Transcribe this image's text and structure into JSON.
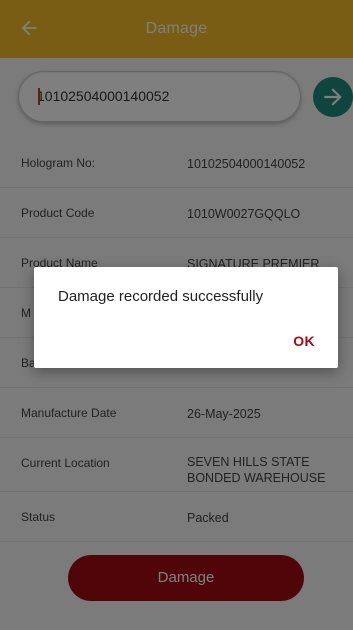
{
  "appbar": {
    "title": "Damage",
    "back_icon": "arrow-left-icon",
    "color": "#f4ba2b"
  },
  "search": {
    "value": "10102504000140052",
    "go_icon": "arrow-right-icon",
    "go_color": "#1f8a78"
  },
  "details": [
    {
      "label": "Hologram No:",
      "value": "10102504000140052"
    },
    {
      "label": "Product Code",
      "value": "1010W0027GQQLO"
    },
    {
      "label": "Product Name",
      "value": "SIGNATURE PREMIER"
    },
    {
      "label": "M",
      "value": ""
    },
    {
      "label": "Ba",
      "value": ""
    },
    {
      "label": "Manufacture Date",
      "value": "26-May-2025"
    },
    {
      "label": "Current Location",
      "value": "SEVEN HILLS STATE BONDED WAREHOUSE"
    },
    {
      "label": "Status",
      "value": "Packed"
    }
  ],
  "action": {
    "label": "Damage",
    "color": "#a10d12"
  },
  "dialog": {
    "message": "Damage recorded successfully",
    "ok_label": "OK"
  }
}
